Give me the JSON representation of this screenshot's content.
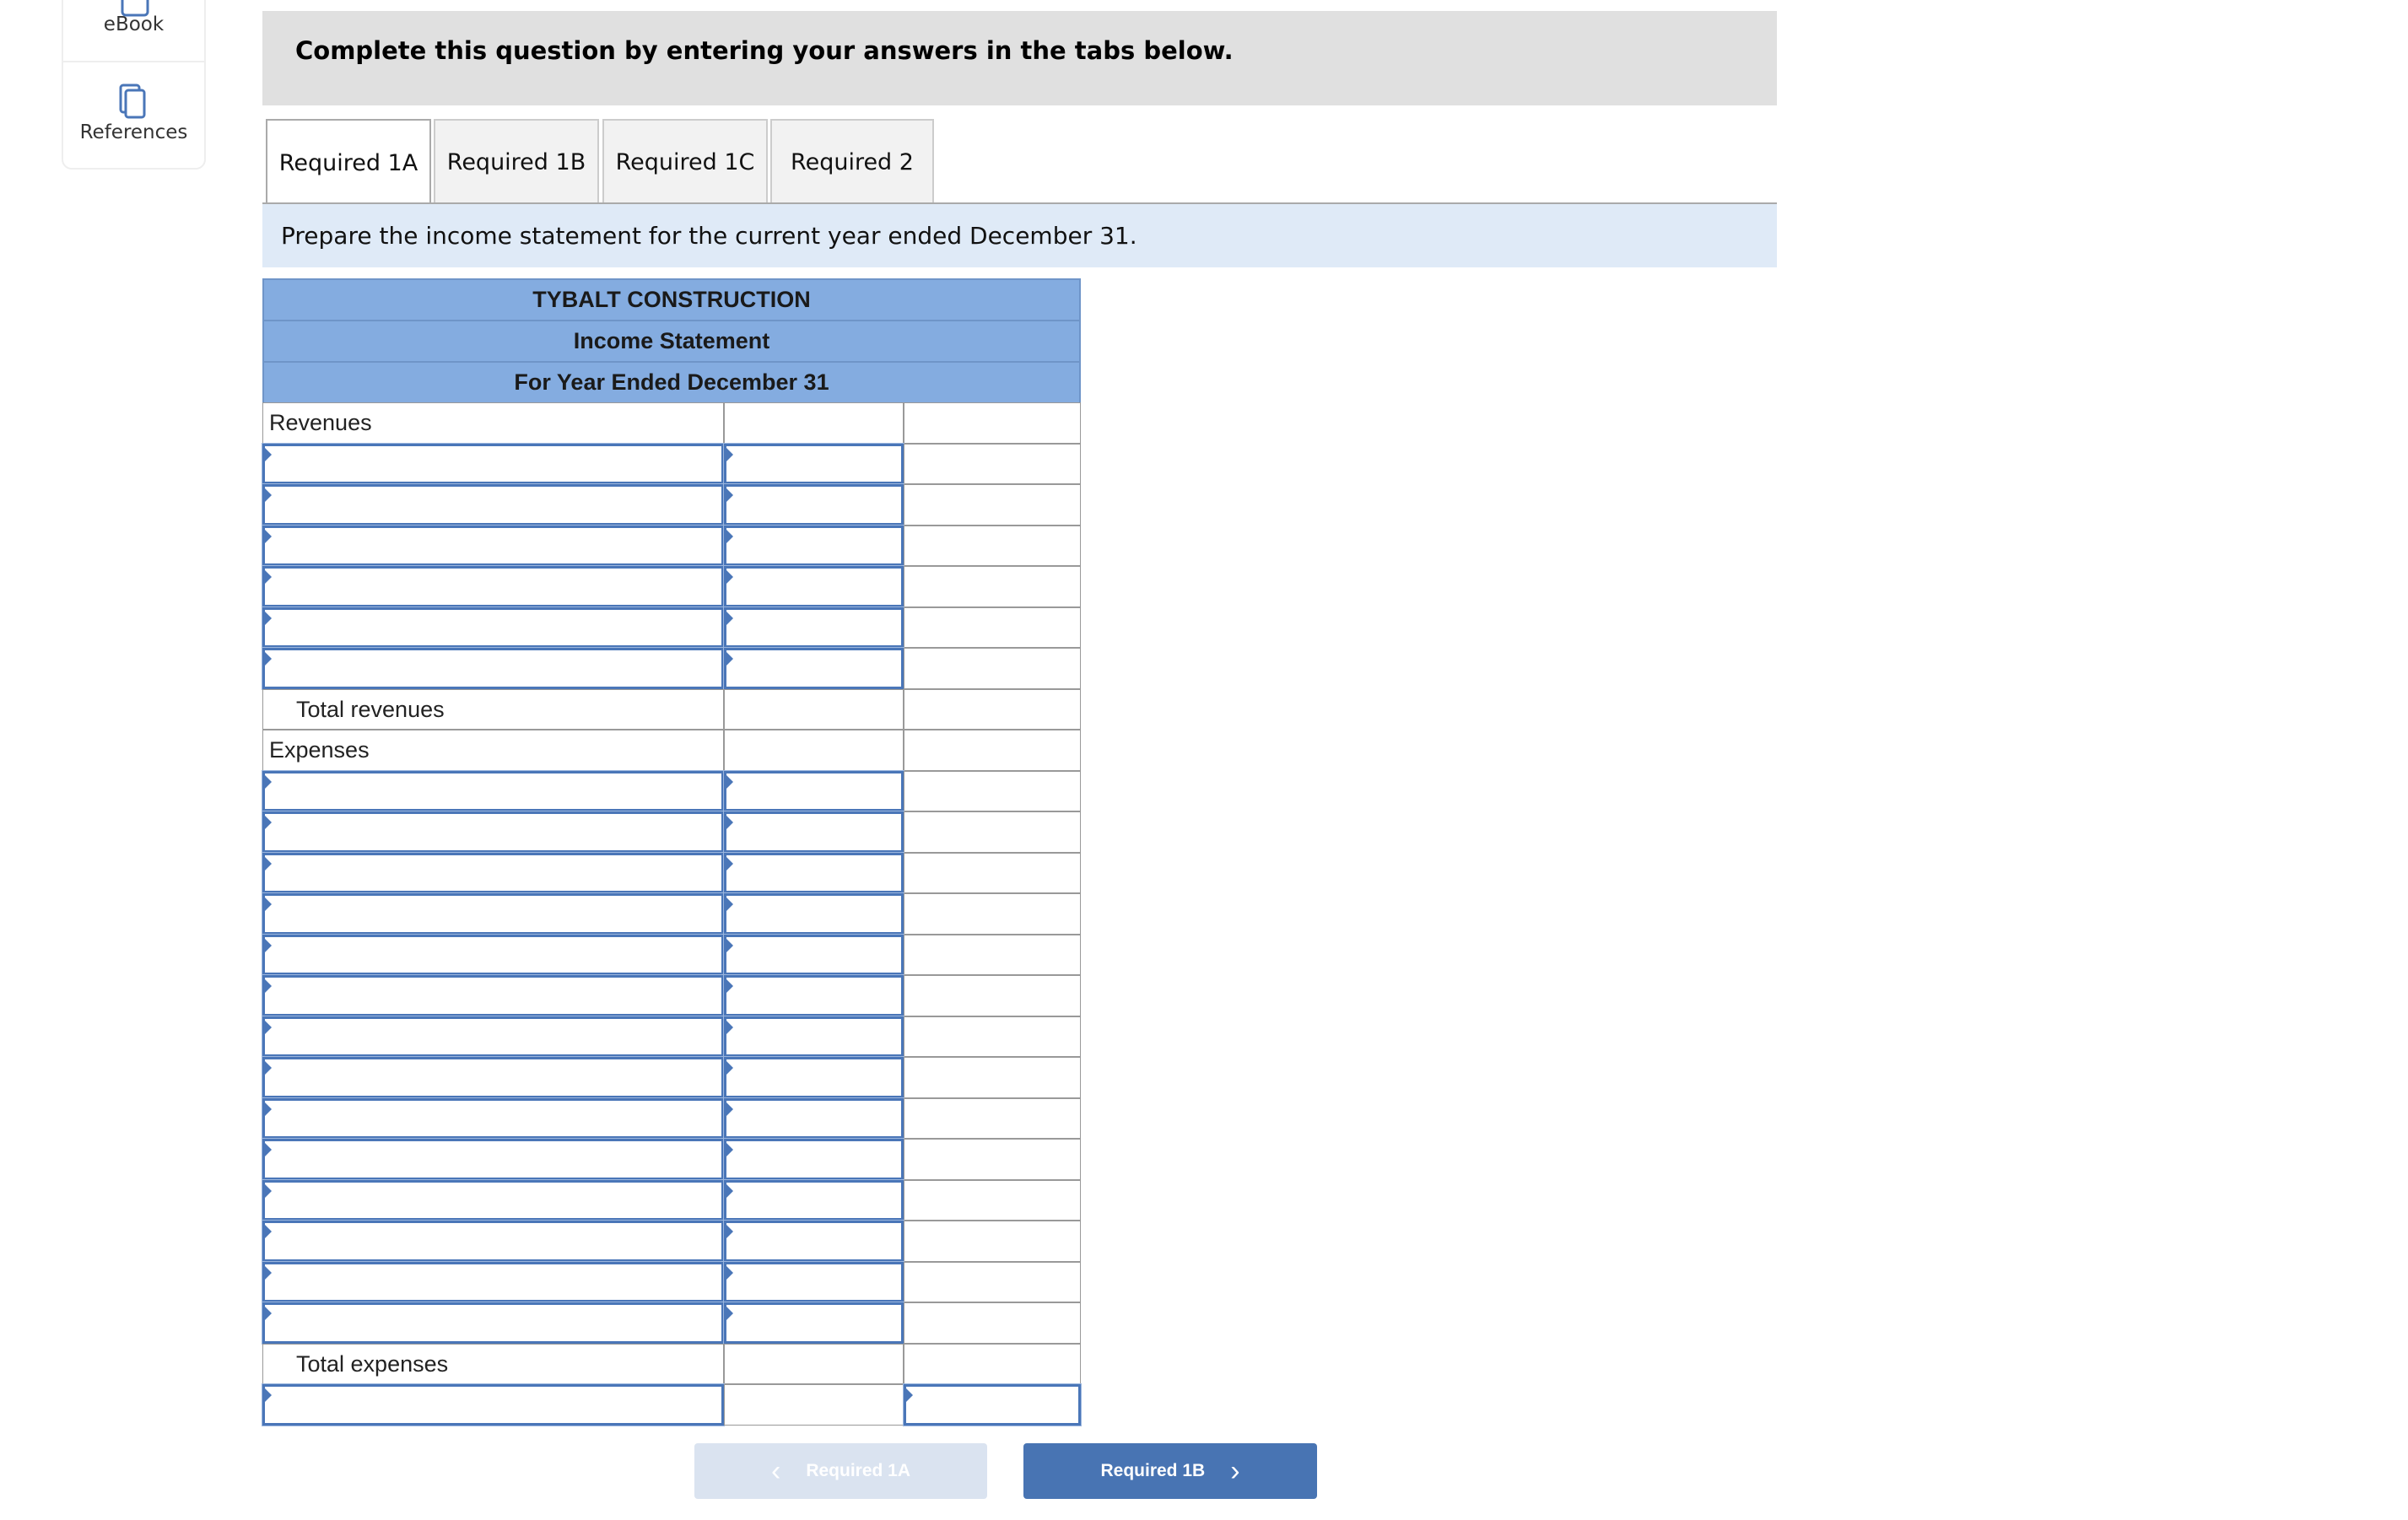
{
  "sidebar": {
    "ebook": "eBook",
    "references": "References"
  },
  "instruction": "Complete this question by entering your answers in the tabs below.",
  "tabs": [
    {
      "label": "Required 1A",
      "active": true
    },
    {
      "label": "Required 1B"
    },
    {
      "label": "Required 1C"
    },
    {
      "label": "Required 2"
    }
  ],
  "prompt": "Prepare the income statement for the current year ended December 31.",
  "statement": {
    "company": "TYBALT CONSTRUCTION",
    "title": "Income Statement",
    "period": "For Year Ended December 31",
    "rows": [
      {
        "type": "label",
        "text": "Revenues"
      },
      {
        "type": "input"
      },
      {
        "type": "input"
      },
      {
        "type": "input"
      },
      {
        "type": "input"
      },
      {
        "type": "input"
      },
      {
        "type": "input"
      },
      {
        "type": "total",
        "text": "Total revenues"
      },
      {
        "type": "label",
        "text": "Expenses"
      },
      {
        "type": "input"
      },
      {
        "type": "input"
      },
      {
        "type": "input"
      },
      {
        "type": "input"
      },
      {
        "type": "input"
      },
      {
        "type": "input"
      },
      {
        "type": "input"
      },
      {
        "type": "input"
      },
      {
        "type": "input"
      },
      {
        "type": "input"
      },
      {
        "type": "input"
      },
      {
        "type": "input"
      },
      {
        "type": "input"
      },
      {
        "type": "input"
      },
      {
        "type": "total",
        "text": "Total expenses"
      },
      {
        "type": "final"
      }
    ]
  },
  "nav": {
    "prev": "Required 1A",
    "next": "Required 1B"
  },
  "colors": {
    "accent": "#4874b3",
    "header": "#84ace0",
    "banner": "#dfeaf7"
  }
}
